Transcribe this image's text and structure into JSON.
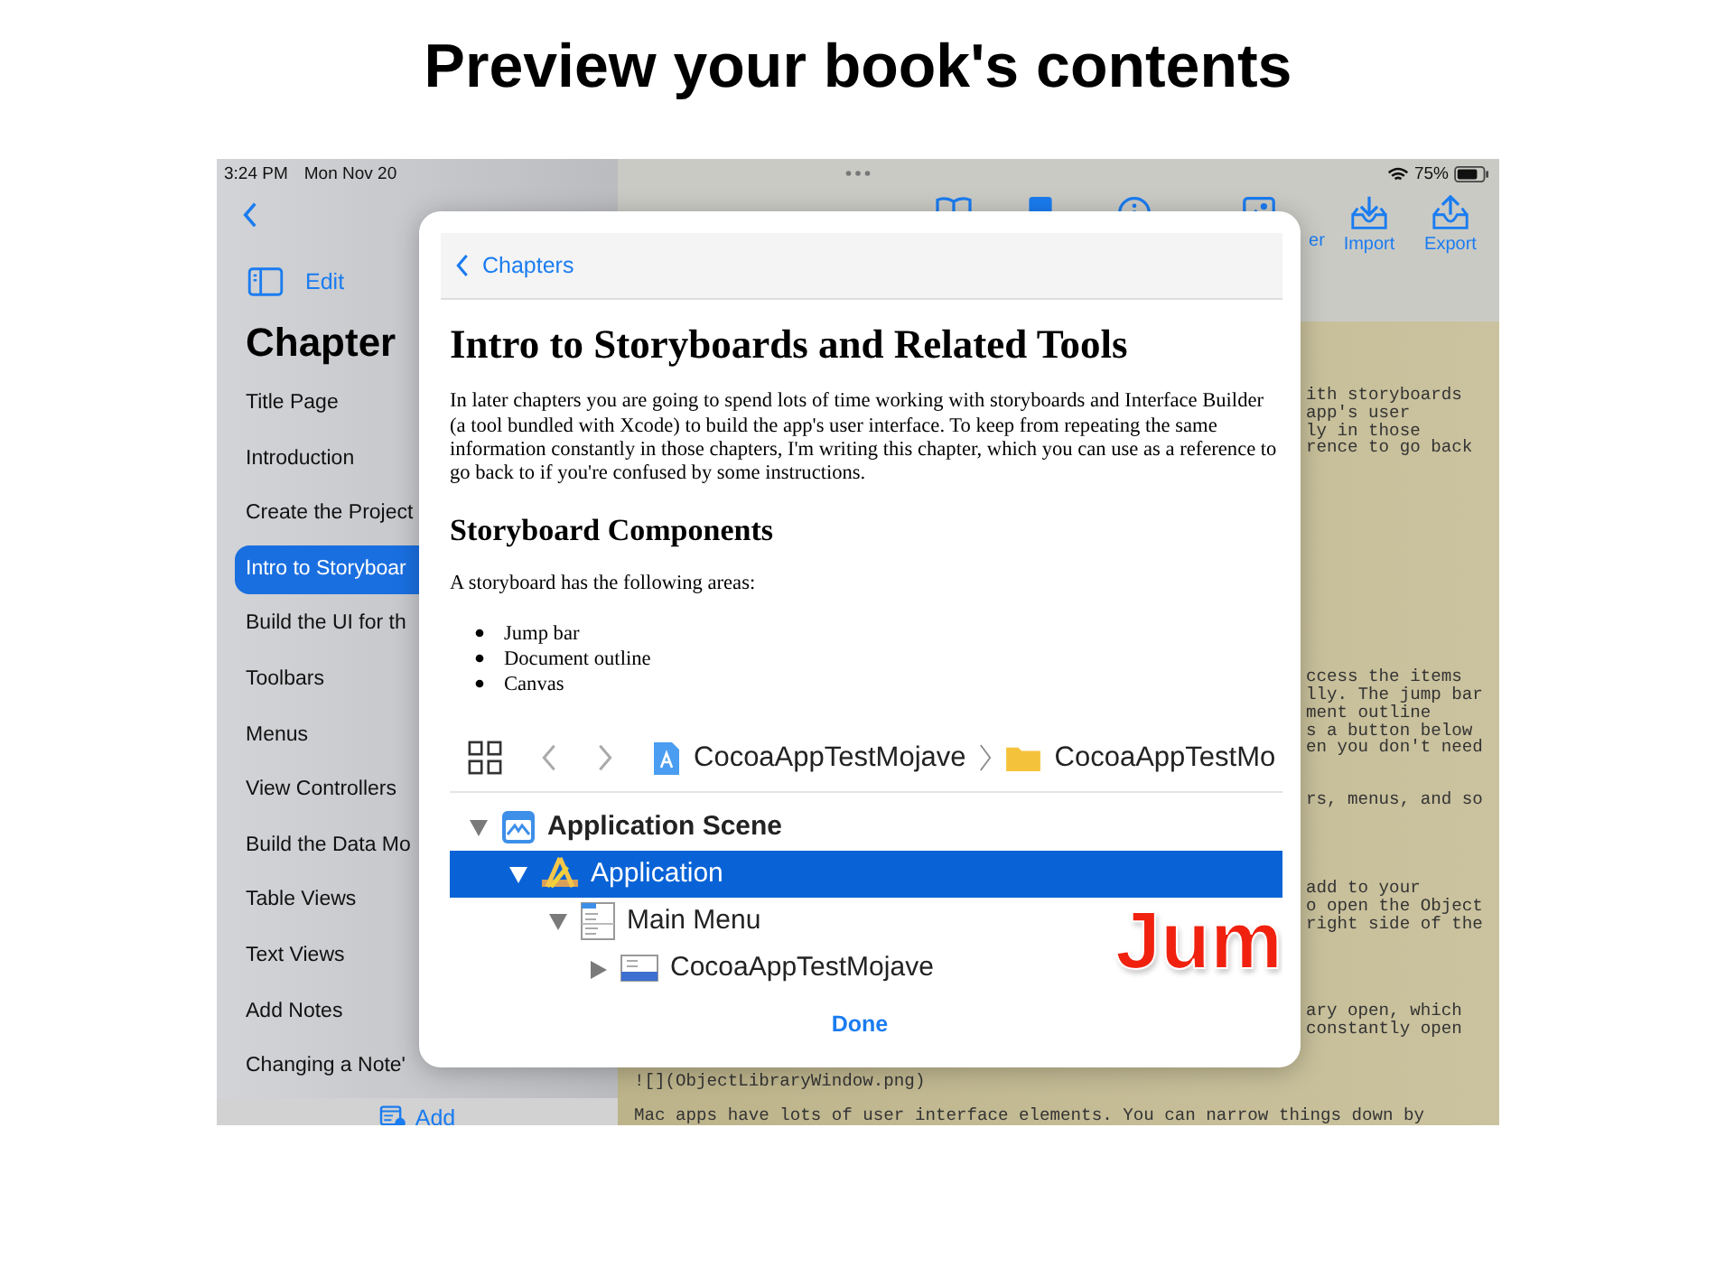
{
  "headline": "Preview your book's contents",
  "status_bar": {
    "time": "3:24 PM",
    "date": "Mon Nov 20",
    "battery": "75%"
  },
  "sidebar": {
    "edit": "Edit",
    "title": "Chapter",
    "add": "Add",
    "items": [
      {
        "label": "Title Page",
        "selected": false
      },
      {
        "label": "Introduction",
        "selected": false
      },
      {
        "label": "Create the Project",
        "selected": false
      },
      {
        "label": "Intro to Storyboar",
        "selected": true
      },
      {
        "label": "Build the UI for th",
        "selected": false
      },
      {
        "label": "Toolbars",
        "selected": false
      },
      {
        "label": "Menus",
        "selected": false
      },
      {
        "label": "View Controllers",
        "selected": false
      },
      {
        "label": "Build the Data Mo",
        "selected": false
      },
      {
        "label": "Table Views",
        "selected": false
      },
      {
        "label": "Text Views",
        "selected": false
      },
      {
        "label": "Add Notes",
        "selected": false
      },
      {
        "label": "Changing a Note'",
        "selected": false
      }
    ]
  },
  "toolbar": {
    "items": [
      {
        "kind": "book"
      },
      {
        "kind": "book-filled"
      },
      {
        "kind": "info"
      },
      {
        "kind": "image",
        "label": "er"
      },
      {
        "kind": "import",
        "label": "Import"
      },
      {
        "kind": "export",
        "label": "Export"
      }
    ]
  },
  "editor": {
    "paragraphs": [
      [
        "ith storyboards",
        "app's user",
        "ly in those",
        "rence to go back"
      ],
      [
        "ccess the items",
        "lly. The jump bar",
        "ment outline",
        "s a button below",
        "en you don't need"
      ],
      [
        "rs, menus, and so"
      ],
      [
        "add to your",
        "o open the Object",
        "right side of the"
      ],
      [
        "ary open, which",
        "constantly open"
      ],
      [
        "![](ObjectLibraryWindow.png)"
      ],
      [
        "Mac apps have lots of user interface elements. You can narrow things down by"
      ]
    ]
  },
  "modal": {
    "back": "Chapters",
    "title": "Intro to Storyboards and Related Tools",
    "intro": "In later chapters you are going to spend lots of time working with storyboards and Interface Builder (a tool bundled with Xcode) to build the app's user interface. To keep from repeating the same information constantly in those chapters, I'm writing this chapter, which you can use as a reference to go back to if you're confused by some instructions.",
    "section": "Storyboard Components",
    "lead": "A storyboard has the following areas:",
    "bullets": [
      "Jump bar",
      "Document outline",
      "Canvas"
    ],
    "figure": {
      "breadcrumbs": [
        "CocoaAppTestMojave",
        "CocoaAppTestMo"
      ],
      "tree": [
        {
          "label": "Application Scene",
          "kind": "scene",
          "expanded": true,
          "selected": false,
          "children": [
            {
              "label": "Application",
              "kind": "app",
              "expanded": true,
              "selected": true,
              "children": [
                {
                  "label": "Main Menu",
                  "kind": "menu",
                  "expanded": true,
                  "selected": false,
                  "children": [
                    {
                      "label": "CocoaAppTestMojave",
                      "kind": "menu-item",
                      "expanded": false,
                      "selected": false
                    }
                  ]
                }
              ]
            }
          ]
        }
      ],
      "callout": "Jum"
    },
    "done": "Done"
  }
}
